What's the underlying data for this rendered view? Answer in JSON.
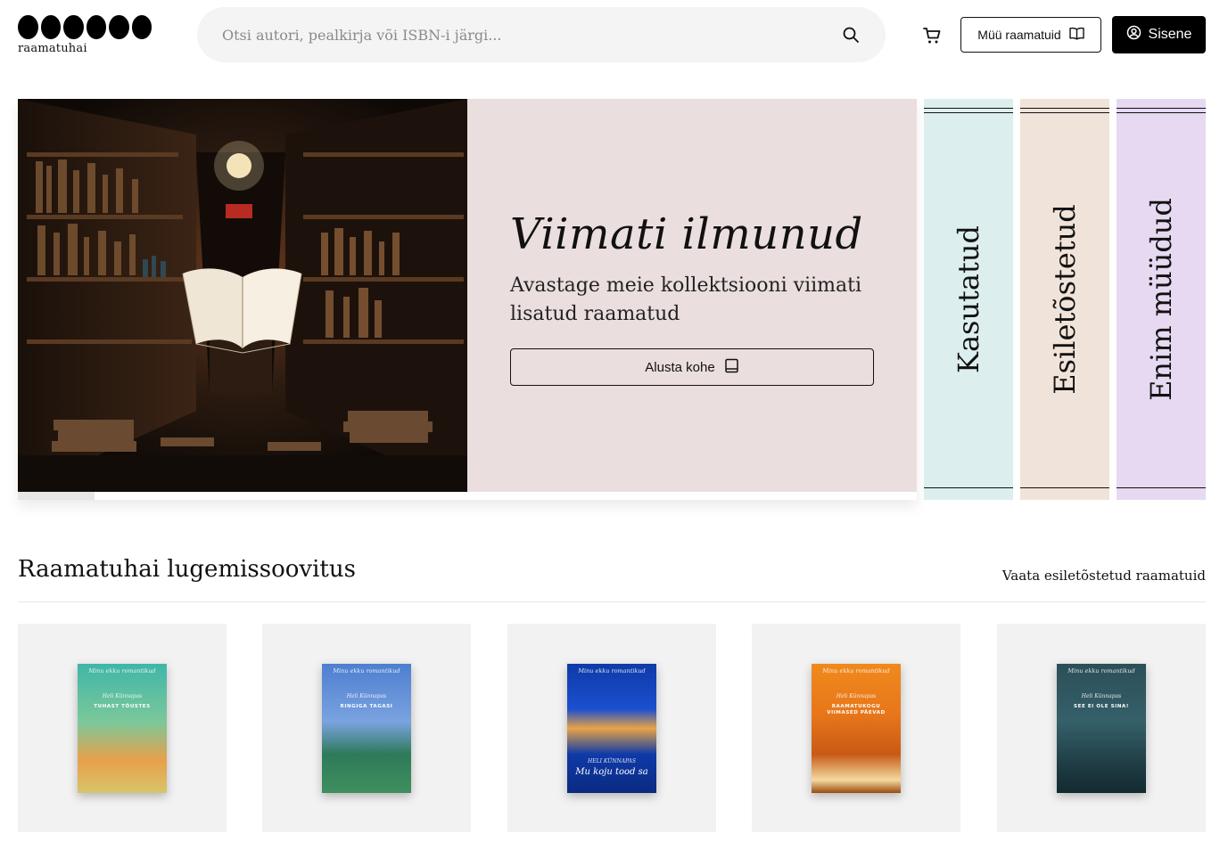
{
  "header": {
    "logo_text": "raamatuhai",
    "search_placeholder": "Otsi autori, pealkirja või ISBN-i järgi...",
    "sell_label": "Müü raamatuid",
    "login_label": "Sisene"
  },
  "hero": {
    "title": "Viimati ilmunud",
    "subtitle": "Avastage meie kollektsiooni viimati lisatud raamatud",
    "cta_label": "Alusta kohe",
    "background_color": "#ebdede",
    "slide_progress": 0.085
  },
  "tabs": [
    {
      "label": "Kasutatud",
      "color": "#ddeeee"
    },
    {
      "label": "Esiletõstetud",
      "color": "#f0e3d9"
    },
    {
      "label": "Enim müüdud",
      "color": "#e6d9f1"
    }
  ],
  "recommendations": {
    "title": "Raamatuhai lugemissoovitus",
    "link_label": "Vaata esiletõstetud raamatuid",
    "books": [
      {
        "series": "Minu ekku romantikud",
        "author": "Heli Künnapas",
        "title": "TUHAST TÕUSTES"
      },
      {
        "series": "Minu ekku romantikud",
        "author": "Heli Künnapas",
        "title": "RINGIGA TAGASI"
      },
      {
        "series": "Minu ekku romantikud",
        "author": "HELI KÜNNAPAS",
        "title": "Mu koju tood sa"
      },
      {
        "series": "Minu ekku romantikud",
        "author": "Heli Künnapas",
        "title": "RAAMATUKOGU VIIMASED PÄEVAD"
      },
      {
        "series": "Minu ekku romantikud",
        "author": "Heli Künnapas",
        "title": "SEE EI OLE SINA!"
      }
    ]
  }
}
